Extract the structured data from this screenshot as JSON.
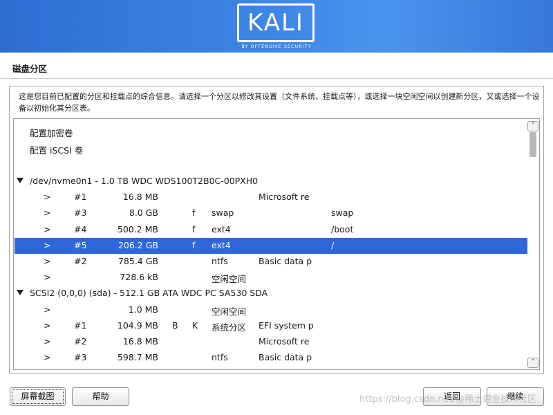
{
  "brand": {
    "logo": "KALI",
    "tagline": "BY OFFENSIVE SECURITY"
  },
  "page_title": "磁盘分区",
  "description": "这是您目前已配置的分区和挂载点的综合信息。请选择一个分区以修改其设置（文件系统、挂载点等），或选择一块空闲空间以创建新分区，又或选择一个设备以初始化其分区表。",
  "actions": [
    {
      "label": "配置加密卷"
    },
    {
      "label": "配置 iSCSI 卷"
    }
  ],
  "devices": [
    {
      "label": "/dev/nvme0n1 - 1.0 TB WDC WDS100T2B0C-00PXH0",
      "partitions": [
        {
          "arrow": ">",
          "num": "#1",
          "size": "16.8 MB",
          "flag1": "",
          "flag2": "",
          "fs": "",
          "name": "Microsoft re",
          "mount": "",
          "selected": false
        },
        {
          "arrow": ">",
          "num": "#3",
          "size": "8.0 GB",
          "flag1": "",
          "flag2": "f",
          "fs": "swap",
          "name": "",
          "mount": "swap",
          "selected": false
        },
        {
          "arrow": ">",
          "num": "#4",
          "size": "500.2 MB",
          "flag1": "",
          "flag2": "f",
          "fs": "ext4",
          "name": "",
          "mount": "/boot",
          "selected": false
        },
        {
          "arrow": ">",
          "num": "#5",
          "size": "206.2 GB",
          "flag1": "",
          "flag2": "f",
          "fs": "ext4",
          "name": "",
          "mount": "/",
          "selected": true
        },
        {
          "arrow": ">",
          "num": "#2",
          "size": "785.4 GB",
          "flag1": "",
          "flag2": "",
          "fs": "ntfs",
          "name": "Basic data p",
          "mount": "",
          "selected": false
        },
        {
          "arrow": ">",
          "num": "",
          "size": "728.6 kB",
          "flag1": "",
          "flag2": "",
          "fs": "空闲空间",
          "name": "",
          "mount": "",
          "selected": false
        }
      ]
    },
    {
      "label": "SCSI2 (0,0,0) (sda) - 512.1 GB ATA WDC PC SA530 SDA",
      "partitions": [
        {
          "arrow": ">",
          "num": "",
          "size": "1.0 MB",
          "flag1": "",
          "flag2": "",
          "fs": "空闲空间",
          "name": "",
          "mount": "",
          "selected": false
        },
        {
          "arrow": ">",
          "num": "#1",
          "size": "104.9 MB",
          "flag1": "B",
          "flag2": "K",
          "fs": "系统分区",
          "name": "EFI system p",
          "mount": "",
          "selected": false
        },
        {
          "arrow": ">",
          "num": "#2",
          "size": "16.8 MB",
          "flag1": "",
          "flag2": "",
          "fs": "",
          "name": "Microsoft re",
          "mount": "",
          "selected": false
        },
        {
          "arrow": ">",
          "num": "#3",
          "size": "598.7 MB",
          "flag1": "",
          "flag2": "",
          "fs": "ntfs",
          "name": "Basic data p",
          "mount": "",
          "selected": false
        }
      ]
    }
  ],
  "scroll_up_glyph": "˄",
  "scroll_down_glyph": "˅",
  "buttons": {
    "screenshot": "屏幕截图",
    "help": "帮助",
    "back": "返回",
    "continue": "继续"
  },
  "watermark": "https://blog.csdn.net/@稀土掘金技术社区"
}
